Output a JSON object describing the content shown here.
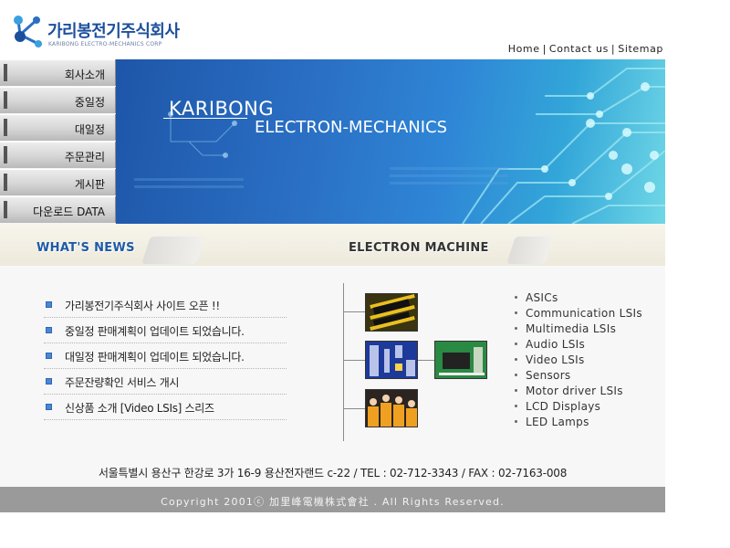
{
  "header": {
    "company_name": "가리봉전기주식회사",
    "company_sub": "KARIBONG ELECTRO-MECHANICS CORP",
    "top_links": [
      "Home",
      "Contact us",
      "Sitemap"
    ],
    "separator": "|"
  },
  "side_nav": {
    "items": [
      "회사소개",
      "중일정",
      "대일정",
      "주문관리",
      "게시판",
      "다운로드 DATA"
    ]
  },
  "banner": {
    "line1": "KARIBONG",
    "line2": "ELECTRON-MECHANICS"
  },
  "news": {
    "title": "WHAT'S NEWS",
    "items": [
      "가리봉전기주식회사 사이트 오픈 !!",
      "중일정 판매계획이 업데이트 되었습니다.",
      "대일정 판매계획이 업데이트 되었습니다.",
      "주문잔량확인 서비스 개시",
      "신상품 소개 [Video LSIs] 스리즈"
    ]
  },
  "machine": {
    "title": "ELECTRON MACHINE",
    "products": [
      "ASICs",
      "Communication LSIs",
      "Multimedia LSIs",
      "Audio LSIs",
      "Video LSIs",
      "Sensors",
      "Motor driver LSIs",
      "LCD Displays",
      "LED Lamps"
    ]
  },
  "footer": {
    "address": "서울특별시 용산구 한강로 3가 16-9 용산전자랜드 c-22 / TEL : 02-712-3343 / FAX : 02-7163-008",
    "copyright": "Copyright 2001ⓒ 加里峰電機株式會社 . All Rights Reserved."
  },
  "colors": {
    "brand_blue": "#1c4f9c",
    "banner_cyan": "#6fd7e6",
    "footer_gray": "#9a9a9a"
  }
}
